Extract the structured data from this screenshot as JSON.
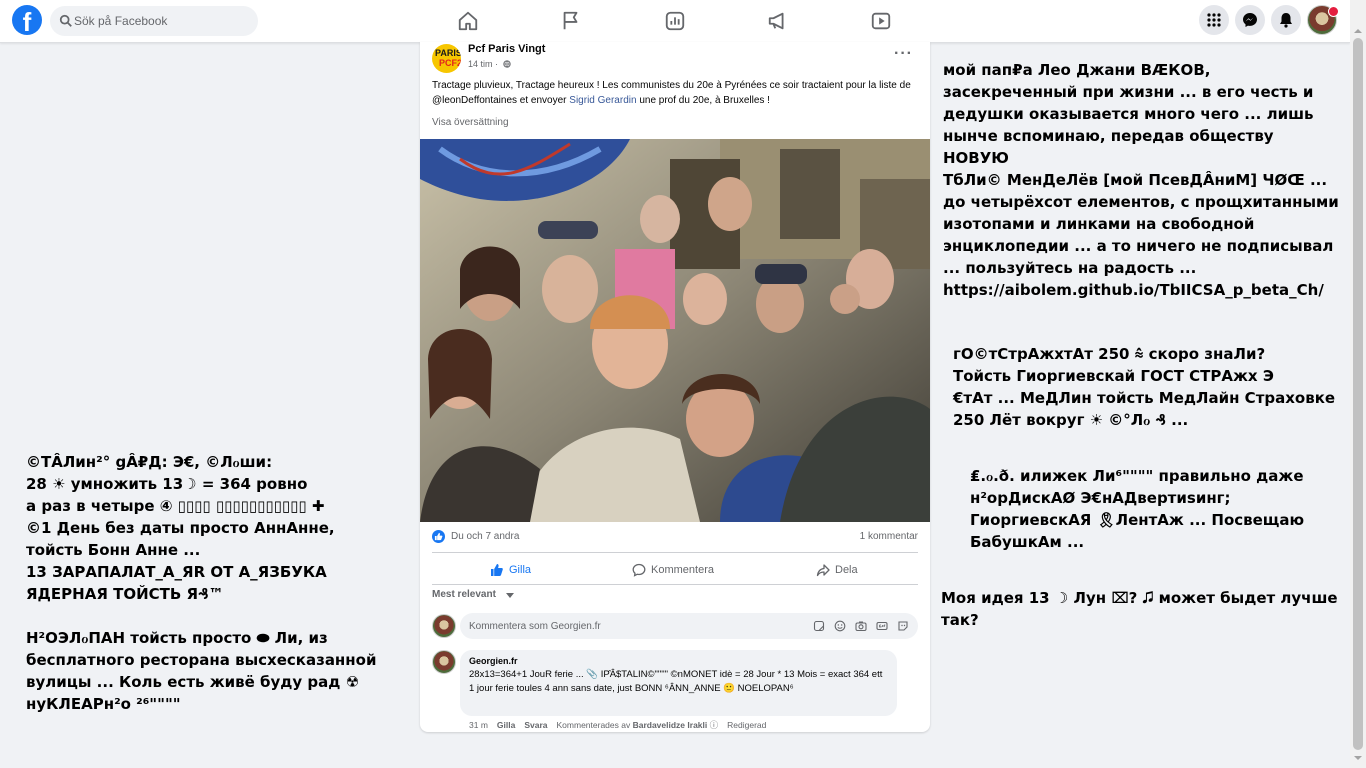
{
  "topbar": {
    "logo_letter": "f",
    "search_placeholder": "Sök på Facebook"
  },
  "post": {
    "page_name": "Pcf Paris Vingt",
    "avatar_line1": "PARIS",
    "avatar_line2": "PCF20",
    "time": "14 tim ·",
    "text_part1": "Tractage pluvieux, Tractage heureux ! Les communistes du 20e à Pyrénées ce soir tractaient pour la liste de @leonDeffontaines  et envoyer ",
    "text_link": "Sigrid Gerardin",
    "text_part2": " une prof du 20e, à Bruxelles !",
    "translate_label": "Visa översättning",
    "reactions_text": "Du och 7 andra",
    "comments_count": "1 kommentar",
    "actions": {
      "like": "Gilla",
      "comment": "Kommentera",
      "share": "Dela"
    },
    "sort_label": "Mest relevant",
    "comment_placeholder": "Kommentera som Georgien.fr",
    "comment": {
      "author": "Georgien.fr",
      "text": "28x13=364+1 JouR ferie ... 📎 IР̂Â$TALIN©\"\"\"\" ©nMONET idè = 28 Jour * 13 Mois = exact 364 ett 1 jour ferie toules 4 ann sans date, just BONN ⁶ÂNN_ANNE 🙂 NOELOPAN⁶",
      "time": "31 m",
      "like": "Gilla",
      "reply": "Svara",
      "commented_by_prefix": "Kommenterades av",
      "commented_by_name": "Bardavelidze Irakli",
      "edited": "Redigerad"
    }
  },
  "overlays": {
    "right_top": "мой пап₽а Лео Джани ВÆКОВ,\nзасекреченный при жизни ... в его честь и\nдедушки оказывается много чего ... лишь\nнынче вспоминаю, передав обществу НОВУЮ\nТбЛи© МенДеЛёв [мой ПсевДÂниМ] ЧØŒ   ...\nдо четырёхсот елементов, с прощхитанными\nизотопами и линками на свободной\nэнциклопедии ... а то ничего не подписывал\n... пользуйтесь на радость ...\nhttps://aibolem.github.io/TbIICSA_p_beta_Ch/",
    "right_mid": "гО©тСтрАжхтАт 250 ⩯ скоро знаЛи?\nТойсть Гиоргиевскай ГОСТ СТРАжх Э\n€тАт ... МеДЛин тойсть МедЛайн Страховке\n250 Лёт вокруг ☀ ©°Лℴ ₰ ...",
    "right_low": "₤.ℴ.ð. илижек Ли⁶\"\"\"\" правильно даже\nн²орДискАØ Э€нАДвертиsинг;\nГиоргиевскАЯ  🎗ЛентАж ... Посвещаю\nБабушкАм ...",
    "right_bottom": "Моя идея 13 ☽ Лун ⌧? 🎜 может быдет лучше\nтак?",
    "left": "©ТÂЛин²° gÂ₽Д: Э€, ©Лℴши:\n28 ☀ умножить 13☽  =  364 ровно\nа раз в четыре ④   ▯▯▯▯ ▯▯▯▯▯▯▯▯▯▯▯ ✚\n©1 День без даты просто АннАнне,\nтойсть Бонн Анне ...\n13 ЗАРАПАЛАТ_А_ЯR  ОТ А_ЯЗБУКА\nЯДЕРНАЯ  ТОЙСТЬ Я₰™\n\nН²ОЭЛℴПАН тойсть просто ⬬ Ли, из\nбесплатного ресторана высхесказанной\nвулицы ... Коль есть живё буду рад ☢\nнуКЛЕАРн²о ²⁶\"\"\"\""
  },
  "colors": {
    "brand": "#1877f2",
    "notification": "#e41e3f",
    "background": "#f0f2f5"
  },
  "icons": [
    "facebook-logo",
    "search-icon",
    "home-icon",
    "flag-icon",
    "chart-icon",
    "megaphone-icon",
    "video-icon",
    "menu-grid-icon",
    "messenger-icon",
    "bell-icon",
    "globe-icon",
    "thumbs-up-icon",
    "comment-icon",
    "share-icon"
  ]
}
